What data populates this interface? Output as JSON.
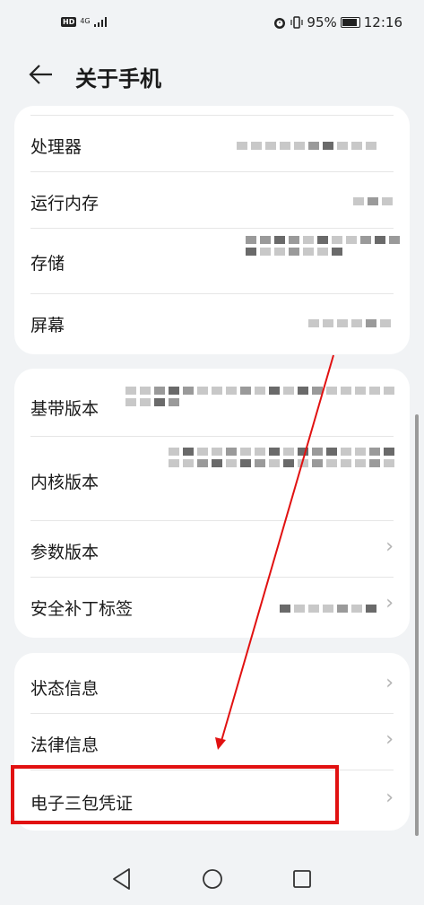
{
  "status_bar": {
    "badge": "HD",
    "network": "4G",
    "battery": "95%",
    "battery_level": 0.95,
    "time": "12:16"
  },
  "header": {
    "back_icon": "back-arrow-icon",
    "title": "关于手机"
  },
  "group1": [
    {
      "label": "处理器"
    },
    {
      "label": "运行内存"
    },
    {
      "label": "存储"
    },
    {
      "label": "屏幕"
    }
  ],
  "group2": [
    {
      "label": "基带版本"
    },
    {
      "label": "内核版本"
    },
    {
      "label": "参数版本"
    },
    {
      "label": "安全补丁标签"
    }
  ],
  "group3": [
    {
      "label": "状态信息"
    },
    {
      "label": "法律信息"
    },
    {
      "label": "电子三包凭证"
    }
  ],
  "annotation": {
    "color": "#e11111"
  },
  "nav": {
    "back_icon": "triangle-back-icon",
    "home_icon": "circle-home-icon",
    "recents_icon": "square-recents-icon"
  }
}
